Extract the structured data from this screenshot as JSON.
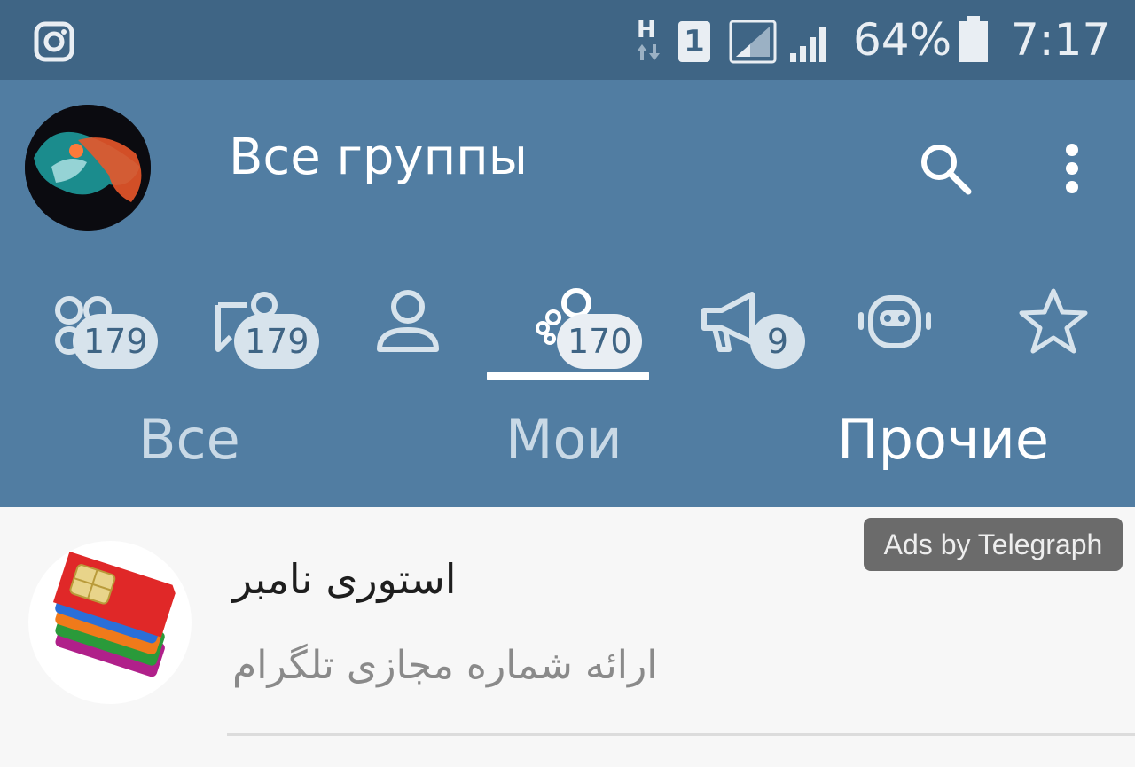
{
  "status_bar": {
    "network_type": "H",
    "sim_slot": "1",
    "battery": "64%",
    "time": "7:17",
    "icons": [
      "instagram-icon",
      "data-arrows-icon",
      "sim-icon",
      "signal-icon",
      "signal-icon",
      "battery-icon"
    ]
  },
  "header": {
    "title": "Все группы",
    "icons": [
      "search-icon",
      "more-vert-icon"
    ]
  },
  "tabs": [
    {
      "icon": "all-chats-icon",
      "badge": "179",
      "selected": false
    },
    {
      "icon": "groups-icon",
      "badge": "179",
      "selected": false
    },
    {
      "icon": "user-icon",
      "badge": "",
      "selected": false
    },
    {
      "icon": "supergroup-icon",
      "badge": "170",
      "selected": true
    },
    {
      "icon": "channel-icon",
      "badge": "9",
      "selected": false
    },
    {
      "icon": "bot-icon",
      "badge": "",
      "selected": false
    },
    {
      "icon": "star-icon",
      "badge": "",
      "selected": false
    }
  ],
  "filters": [
    {
      "label": "Все",
      "active": false
    },
    {
      "label": "Мои",
      "active": false
    },
    {
      "label": "Прочие",
      "active": true
    }
  ],
  "ad": {
    "label": "Ads by Telegraph",
    "title": "استوری نامبر",
    "subtitle": "ارائه شماره مجازی تلگرام"
  },
  "colors": {
    "status_bar": "#3f6585",
    "app_bar": "#517da2",
    "badge_bg": "#d7e3ec",
    "content_bg": "#f7f7f7"
  }
}
